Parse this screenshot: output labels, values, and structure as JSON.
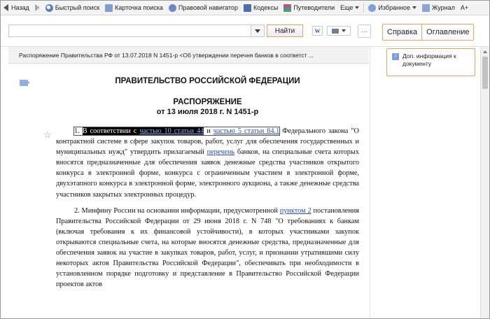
{
  "toolbar": {
    "back": "Назад",
    "quick_search": "Быстрый поиск",
    "search_card": "Карточка поиска",
    "legal_navigator": "Правовой навигатор",
    "codes": "Кодексы",
    "guides": "Путеводители",
    "more": "Еще",
    "favorites": "Избранное",
    "journal": "Журнал",
    "font_size": "A+"
  },
  "search": {
    "value": "",
    "placeholder": "",
    "find_label": "Найти"
  },
  "actions": {
    "word_label": "W",
    "more_label": "···"
  },
  "tabs": {
    "help": "Справка",
    "contents": "Оглавление"
  },
  "document": {
    "header": "Распоряжение Правительства РФ от 13.07.2018 N 1451-р <Об утверждении перечня банков в соответст ...",
    "title_gov": "ПРАВИТЕЛЬСТВО РОССИЙСКОЙ ФЕДЕРАЦИИ",
    "title_order": "РАСПОРЯЖЕНИЕ",
    "title_date": "от 13 июля 2018 г. N 1451-р",
    "p1": {
      "num": "1.",
      "t1": "В соответствии с",
      "link1": "частью 10 статьи 44",
      "t2": "и",
      "link2": "частью 5 статьи 84.1",
      "t3": "Федерального закона \"О контрактной системе в сфере закупок товаров, работ, услуг для обеспечения государственных и муниципальных нужд\" утвердить прилагаемый",
      "link3": "перечень",
      "t4": "банков, на специальные счета которых вносятся предназначенные для обеспечения заявок денежные средства участников открытого конкурса в электронной форме, конкурса с ограниченным участием в электронной форме, двухэтапного конкурса в электронной форме, электронного аукциона, а также денежные средства участников закрытых электронных процедур."
    },
    "p2": {
      "t1": "2. Минфину России на основании информации, предусмотренной",
      "link1": "пунктом 2",
      "t2": "постановления Правительства Российской Федерации от 29 июня 2018 г. N 748 \"О требованиях к банкам (включая требования к их финансовой устойчивости), в которых участниками закупок открываются специальные счета, на которые вносятся денежные средства, предназначенные для обеспечения заявок на участие в закупках товаров, работ, услуг, и признании утратившими силу некоторых актов Правительства Российской Федерации\", обеспечивать при необходимости в установленном порядке подготовку и представление в Правительство Российской Федерации проектов актов"
    }
  },
  "right_panel": {
    "info_label": "Доп. информация к документу"
  },
  "colors": {
    "accent_border": "#e0a65c",
    "link": "#2a4aa8",
    "highlight_bg": "#000000"
  }
}
